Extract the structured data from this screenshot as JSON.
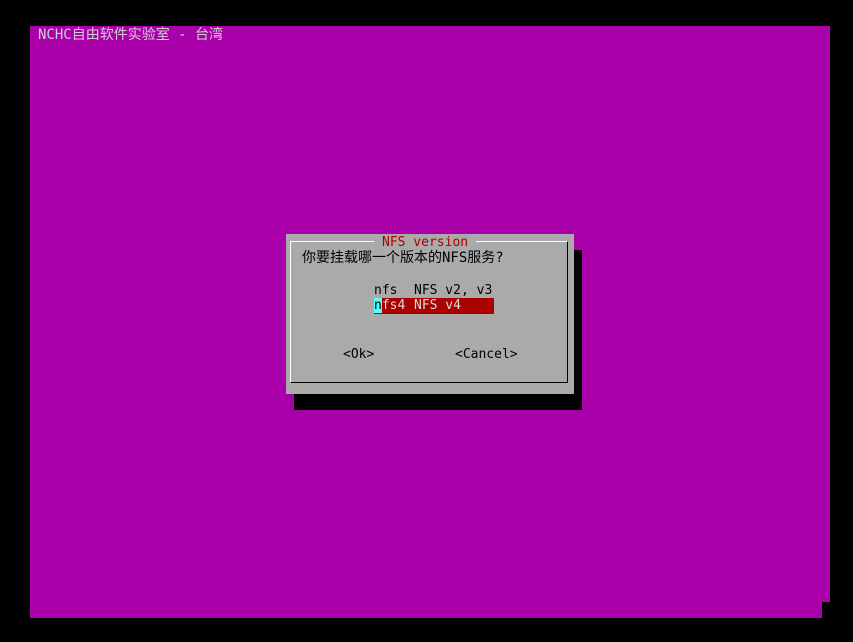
{
  "backtitle": "NCHC自由软件实验室 - 台湾",
  "dialog": {
    "title": "NFS version",
    "prompt": "你要挂载哪一个版本的NFS服务?",
    "options": [
      {
        "tag": "nfs",
        "description": "NFS v2, v3",
        "selected": false
      },
      {
        "tag": "nfs4",
        "description": "NFS v4",
        "selected": true
      }
    ],
    "buttons": {
      "ok": "<Ok>",
      "cancel": "<Cancel>"
    }
  },
  "colors": {
    "backdrop": "#aa00aa",
    "dialog_bg": "#aaaaaa",
    "title_text": "#aa0000",
    "selected_bg": "#aa0000",
    "cursor": "#55ffff"
  }
}
